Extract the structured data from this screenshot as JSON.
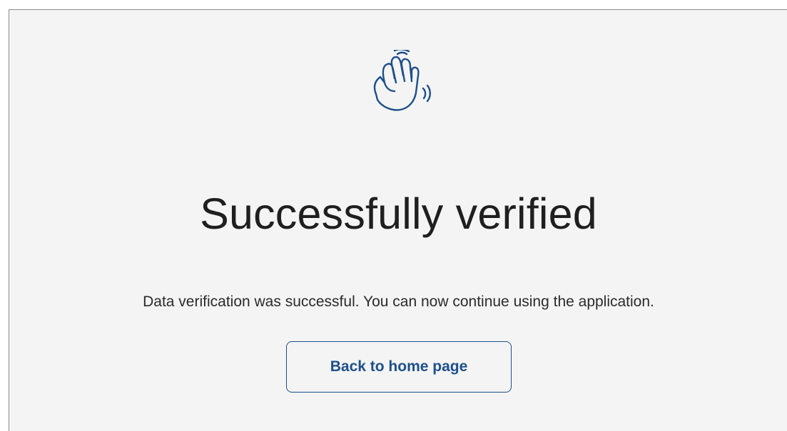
{
  "page": {
    "title": "Successfully verified",
    "message": "Data verification was successful. You can now continue using the application.",
    "icon": "waving-hand-icon",
    "button_label": "Back to home page"
  },
  "colors": {
    "background": "#f4f4f4",
    "accent": "#1e4f8a",
    "text": "#1f1f1f"
  }
}
